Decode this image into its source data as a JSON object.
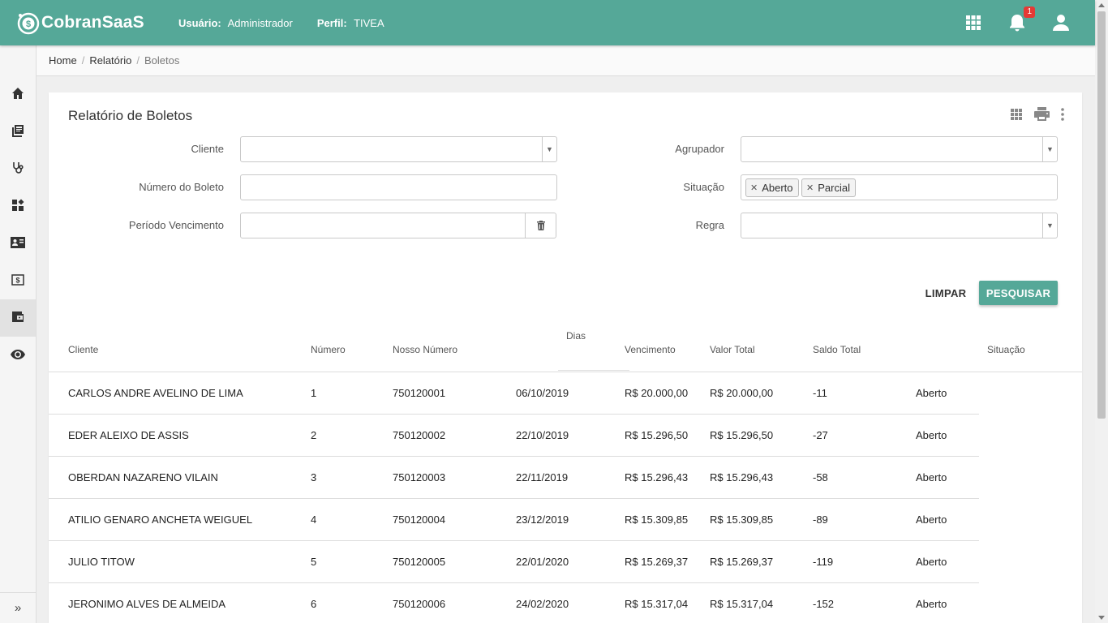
{
  "app": {
    "logo_text": "CobranSaaS",
    "user_label": "Usuário:",
    "user_value": "Administrador",
    "profile_label": "Perfil:",
    "profile_value": "TIVEA",
    "notification_count": "1",
    "accent_color": "#55a898"
  },
  "breadcrumb": [
    "Home",
    "Relatório",
    "Boletos"
  ],
  "sidebar": {
    "icons": [
      "home-icon",
      "book-icon",
      "stethoscope-icon",
      "dashboard-icon",
      "contact-card-icon",
      "money-icon",
      "wallet-icon",
      "eye-icon"
    ],
    "active_index": 6,
    "expand_label": "»"
  },
  "page": {
    "title": "Relatório de Boletos"
  },
  "form": {
    "cliente_label": "Cliente",
    "cliente_value": "",
    "numero_label": "Número do Boleto",
    "numero_value": "",
    "periodo_label": "Período Vencimento",
    "periodo_value": "",
    "agrupador_label": "Agrupador",
    "agrupador_value": "",
    "situacao_label": "Situação",
    "situacao_chips": [
      "Aberto",
      "Parcial"
    ],
    "regra_label": "Regra",
    "regra_value": "",
    "clear_label": "LIMPAR",
    "search_label": "PESQUISAR"
  },
  "table": {
    "columns": {
      "cliente": "Cliente",
      "numero": "Número",
      "nosso_numero": "Nosso Número",
      "dias": "Dias",
      "vencimento": "Vencimento",
      "valor_total": "Valor Total",
      "saldo_total": "Saldo Total",
      "situacao": "Situação"
    },
    "rows": [
      {
        "cliente": "CARLOS ANDRE AVELINO DE LIMA",
        "numero": "1",
        "nosso_numero": "750120001",
        "data": "06/10/2019",
        "valor1": "R$ 20.000,00",
        "valor2": "R$ 20.000,00",
        "dias": "-11",
        "situacao": "Aberto"
      },
      {
        "cliente": "EDER ALEIXO DE ASSIS",
        "numero": "2",
        "nosso_numero": "750120002",
        "data": "22/10/2019",
        "valor1": "R$ 15.296,50",
        "valor2": "R$ 15.296,50",
        "dias": "-27",
        "situacao": "Aberto"
      },
      {
        "cliente": "OBERDAN NAZARENO VILAIN",
        "numero": "3",
        "nosso_numero": "750120003",
        "data": "22/11/2019",
        "valor1": "R$ 15.296,43",
        "valor2": "R$ 15.296,43",
        "dias": "-58",
        "situacao": "Aberto"
      },
      {
        "cliente": "ATILIO GENARO ANCHETA WEIGUEL",
        "numero": "4",
        "nosso_numero": "750120004",
        "data": "23/12/2019",
        "valor1": "R$ 15.309,85",
        "valor2": "R$ 15.309,85",
        "dias": "-89",
        "situacao": "Aberto"
      },
      {
        "cliente": "JULIO TITOW",
        "numero": "5",
        "nosso_numero": "750120005",
        "data": "22/01/2020",
        "valor1": "R$ 15.269,37",
        "valor2": "R$ 15.269,37",
        "dias": "-119",
        "situacao": "Aberto"
      },
      {
        "cliente": "JERONIMO ALVES DE ALMEIDA",
        "numero": "6",
        "nosso_numero": "750120006",
        "data": "24/02/2020",
        "valor1": "R$ 15.317,04",
        "valor2": "R$ 15.317,04",
        "dias": "-152",
        "situacao": "Aberto"
      }
    ]
  }
}
